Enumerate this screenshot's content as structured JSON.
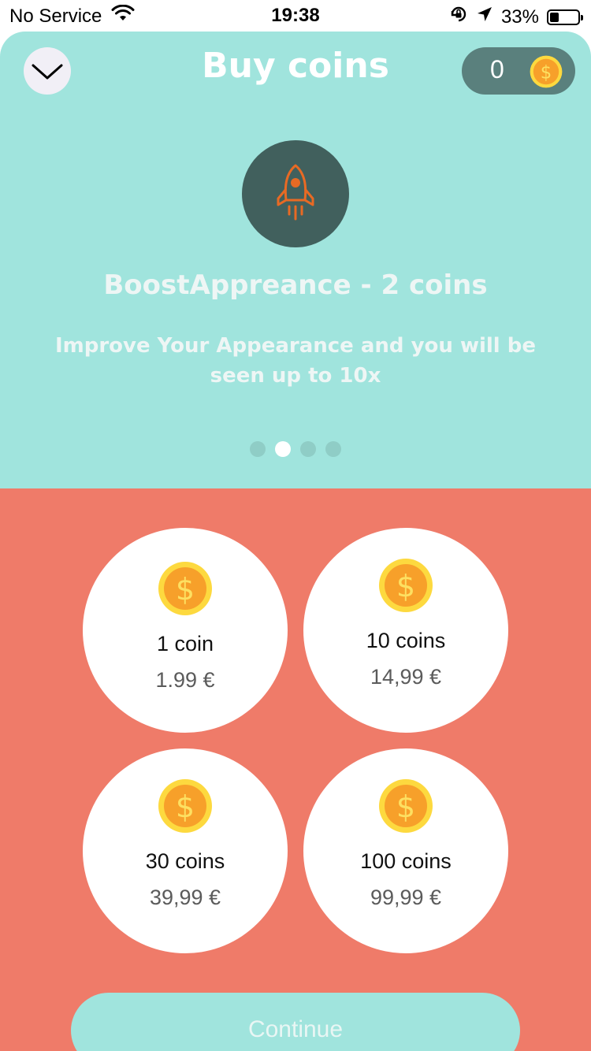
{
  "status_bar": {
    "carrier": "No Service",
    "time": "19:38",
    "battery_percent": "33%",
    "battery_level": 0.33
  },
  "header": {
    "title": "Buy coins",
    "balance": "0",
    "close_icon": "chevron-down-icon",
    "coin_icon": "dollar-coin-icon"
  },
  "feature": {
    "icon": "rocket-icon",
    "title": "BoostAppreance - 2 coins",
    "description": "Improve Your Appearance and you will be seen up to 10x",
    "pages": 4,
    "active_page": 2
  },
  "packs": [
    {
      "name": "1 coin",
      "price": "1.99 €"
    },
    {
      "name": "10 coins",
      "price": "14,99 €"
    },
    {
      "name": "30 coins",
      "price": "39,99 €"
    },
    {
      "name": "100 coins",
      "price": "99,99 €"
    }
  ],
  "footer": {
    "continue_label": "Continue"
  },
  "colors": {
    "top_panel": "#a0e4dd",
    "bottom_panel": "#ef7b69",
    "balance_bg": "#5a807d",
    "coin_gold": "#fbbf2d",
    "rocket": "#e86a24"
  }
}
